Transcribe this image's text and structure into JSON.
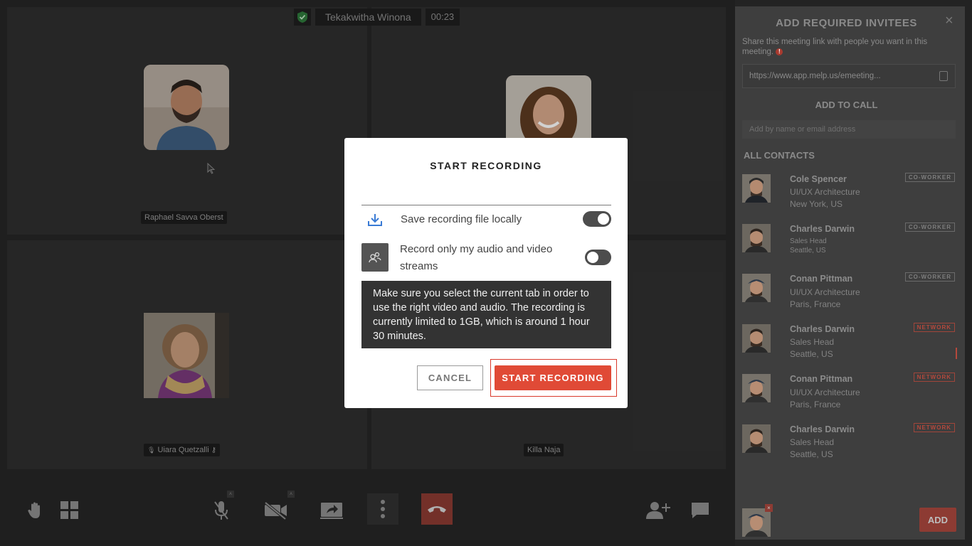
{
  "call": {
    "host_name": "Tekakwitha Winona",
    "timer": "00:23"
  },
  "participants": [
    {
      "name": "Raphael Savva Oberst",
      "muted": false
    },
    {
      "name": "",
      "muted": false
    },
    {
      "name": "Uiara Quetzalli",
      "muted": true
    },
    {
      "name": "Killa Naja",
      "muted": false
    }
  ],
  "controls": {
    "icons": [
      "raise-hand-icon",
      "grid-view-icon",
      "mic-muted-icon",
      "video-off-icon",
      "share-screen-icon",
      "more-icon",
      "end-call-icon",
      "add-participant-icon",
      "chat-icon"
    ]
  },
  "panel": {
    "title": "ADD REQUIRED INVITEES",
    "description": "Share this meeting link with people you want in this meeting.",
    "link": "https://www.app.melp.us/emeeting...",
    "add_to_call": "ADD TO CALL",
    "search_placeholder": "Add by name or email address",
    "all_contacts": "ALL CONTACTS",
    "contacts": [
      {
        "name": "Cole Spencer",
        "role": "UI/UX Architecture",
        "location": "New York, US",
        "tag": "CO-WORKER"
      },
      {
        "name": "Charles Darwin",
        "role": "Sales Head",
        "location": "Seattle, US",
        "tag": "CO-WORKER"
      },
      {
        "name": "Conan Pittman",
        "role": "UI/UX Architecture",
        "location": "Paris, France",
        "tag": "CO-WORKER"
      },
      {
        "name": "Charles Darwin",
        "role": "Sales Head",
        "location": "Seattle, US",
        "tag": "NETWORK"
      },
      {
        "name": "Conan Pittman",
        "role": "UI/UX Architecture",
        "location": "Paris, France",
        "tag": "NETWORK"
      },
      {
        "name": "Charles Darwin",
        "role": "Sales Head",
        "location": "Seattle, US",
        "tag": "NETWORK"
      }
    ],
    "add_button": "ADD"
  },
  "modal": {
    "title": "START RECORDING",
    "option1_label": "Save recording file locally",
    "option1_on": true,
    "option2_label": "Record only my audio and video streams",
    "option2_on": false,
    "notice": "Make sure you select the current tab in order to use the right video and audio. The recording is currently limited to 1GB, which is around 1 hour 30 minutes.",
    "cancel_label": "CANCEL",
    "start_label": "START RECORDING"
  },
  "colors": {
    "accent": "#e04a36",
    "panel_bg": "#3e3e3e",
    "stage_bg": "#262626"
  }
}
